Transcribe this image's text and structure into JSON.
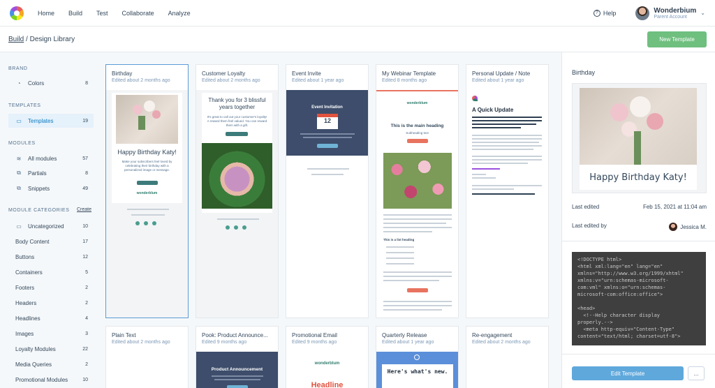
{
  "nav": {
    "items": [
      "Home",
      "Build",
      "Test",
      "Collaborate",
      "Analyze"
    ],
    "help": "Help",
    "account_name": "Wonderbium",
    "account_sub": "Parent Account"
  },
  "breadcrumb": {
    "link": "Build",
    "sep": " / ",
    "current": "Design Library"
  },
  "new_template_label": "New Template",
  "sidebar": {
    "brand_title": "BRAND",
    "brand_items": [
      {
        "label": "Colors",
        "count": "8",
        "icon": "drop-icon"
      }
    ],
    "templates_title": "TEMPLATES",
    "template_items": [
      {
        "label": "Templates",
        "count": "19",
        "icon": "document-icon"
      }
    ],
    "modules_title": "MODULES",
    "module_items": [
      {
        "label": "All modules",
        "count": "57",
        "icon": "layers-icon"
      },
      {
        "label": "Partials",
        "count": "8",
        "icon": "partials-icon"
      },
      {
        "label": "Snippets",
        "count": "49",
        "icon": "snippets-icon"
      }
    ],
    "categories_title": "MODULE CATEGORIES",
    "create_label": "Create",
    "categories": [
      {
        "label": "Uncategorized",
        "count": "10",
        "icon": "folder-icon"
      },
      {
        "label": "Body Content",
        "count": "17"
      },
      {
        "label": "Buttons",
        "count": "12"
      },
      {
        "label": "Containers",
        "count": "5"
      },
      {
        "label": "Footers",
        "count": "2"
      },
      {
        "label": "Headers",
        "count": "2"
      },
      {
        "label": "Headlines",
        "count": "4"
      },
      {
        "label": "Images",
        "count": "3"
      },
      {
        "label": "Loyalty Modules",
        "count": "22"
      },
      {
        "label": "Media Queries",
        "count": "2"
      },
      {
        "label": "Promotional Modules",
        "count": "10"
      }
    ]
  },
  "cards": [
    {
      "title": "Birthday",
      "edited": "Edited about 2 months ago",
      "preview": {
        "heading": "Happy Birthday Katy!",
        "body": "Make your subscribers feel loved by celebrating their birthday with a personalized image or message.",
        "brand": "wonderblum"
      }
    },
    {
      "title": "Customer Loyalty",
      "edited": "Edited about 2 months ago",
      "preview": {
        "heading": "Thank you for 3 blissful years together",
        "body": "It's great to call out your customer's loyalty! A reward them feel valued. You can reward them with a gift."
      }
    },
    {
      "title": "Event Invite",
      "edited": "Edited about 1 year ago",
      "preview": {
        "heading": "Event Invitation",
        "day": "12"
      }
    },
    {
      "title": "My Webinar Template",
      "edited": "Edited 8 months ago",
      "preview": {
        "brand": "wonderblum",
        "heading": "This is the main heading",
        "sub": "Subheading text",
        "list_heading": "This is a list heading"
      }
    },
    {
      "title": "Personal Update / Note",
      "edited": "Edited about 1 year ago",
      "preview": {
        "heading": "A Quick Update"
      }
    },
    {
      "title": "Plain Text",
      "edited": "Edited about 2 months ago"
    },
    {
      "title": "Pook: Product Announce...",
      "edited": "Edited 9 months ago",
      "preview": {
        "heading": "Product Announcement"
      }
    },
    {
      "title": "Promotional Email",
      "edited": "Edited 9 months ago",
      "preview": {
        "brand": "wonderblum",
        "heading": "Headline"
      }
    },
    {
      "title": "Quarterly Release",
      "edited": "Edited about 1 year ago",
      "preview": {
        "heading": "Here's what's new."
      }
    },
    {
      "title": "Re-engagement",
      "edited": "Edited about 2 months ago"
    }
  ],
  "details": {
    "title": "Birthday",
    "preview_heading": "Happy Birthday Katy!",
    "last_edited_label": "Last edited",
    "last_edited_value": "Feb 15, 2021 at 11:04 am",
    "edited_by_label": "Last edited by",
    "edited_by_value": "Jessica M.",
    "code": "<!DOCTYPE html>\n<html xml:lang=\"en\" lang=\"en\"\nxmlns=\"http://www.w3.org/1999/xhtml\"\nxmlns:v=\"urn:schemas-microsoft-\ncom:vml\" xmlns:o=\"urn:schemas-\nmicrosoft-com:office:office\">\n\n<head>\n  <!--Help character display\nproperly.-->\n  <meta http-equiv=\"Content-Type\"\ncontent=\"text/html; charset=utf-8\">",
    "edit_label": "Edit Template",
    "more_label": "..."
  },
  "colors": {
    "accent_green": "#6fbf7f",
    "accent_blue": "#5fa8dc",
    "selected_border": "#5b9bd5",
    "navy": "#3d4d6b",
    "teal": "#4a9d8f",
    "coral": "#e8735f"
  }
}
